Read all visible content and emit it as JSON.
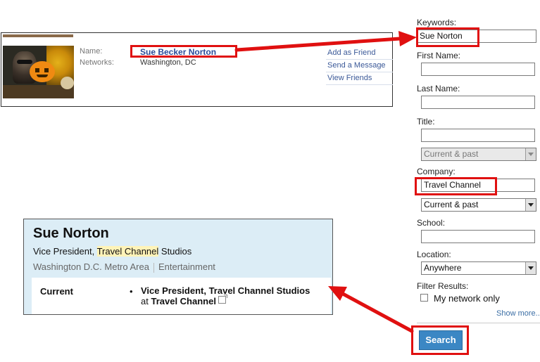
{
  "facebook_card": {
    "name_label": "Name:",
    "networks_label": "Networks:",
    "name": "Sue Becker Norton",
    "network": "Washington, DC",
    "actions": [
      "Add as Friend",
      "Send a Message",
      "View Friends"
    ]
  },
  "linkedin_card": {
    "name": "Sue Norton",
    "title_prefix": "Vice President, ",
    "title_hl1": "Travel",
    "title_space": " ",
    "title_hl2": "Channel",
    "title_suffix": " Studios",
    "location": "Washington D.C. Metro Area",
    "industry": "Entertainment",
    "current_label": "Current",
    "position": "Vice President, Travel Channel Studios",
    "at_text": "at ",
    "company": "Travel Channel"
  },
  "search_form": {
    "keywords_label": "Keywords:",
    "keywords_value": "Sue Norton",
    "first_name_label": "First Name:",
    "first_name_value": "",
    "last_name_label": "Last Name:",
    "last_name_value": "",
    "title_label": "Title:",
    "title_value": "",
    "title_scope": "Current & past",
    "company_label": "Company:",
    "company_value": "Travel Channel",
    "company_scope": "Current & past",
    "school_label": "School:",
    "school_value": "",
    "location_label": "Location:",
    "location_value": "Anywhere",
    "filter_label": "Filter Results:",
    "my_network_only": "My network only",
    "my_network_checked": false,
    "show_more": "Show more...",
    "search_button": "Search"
  },
  "colors": {
    "highlight_red": "#e01010",
    "facebook_link": "#3b5998",
    "linkedin_bg": "#dcedf6",
    "search_button": "#3b87c4"
  }
}
